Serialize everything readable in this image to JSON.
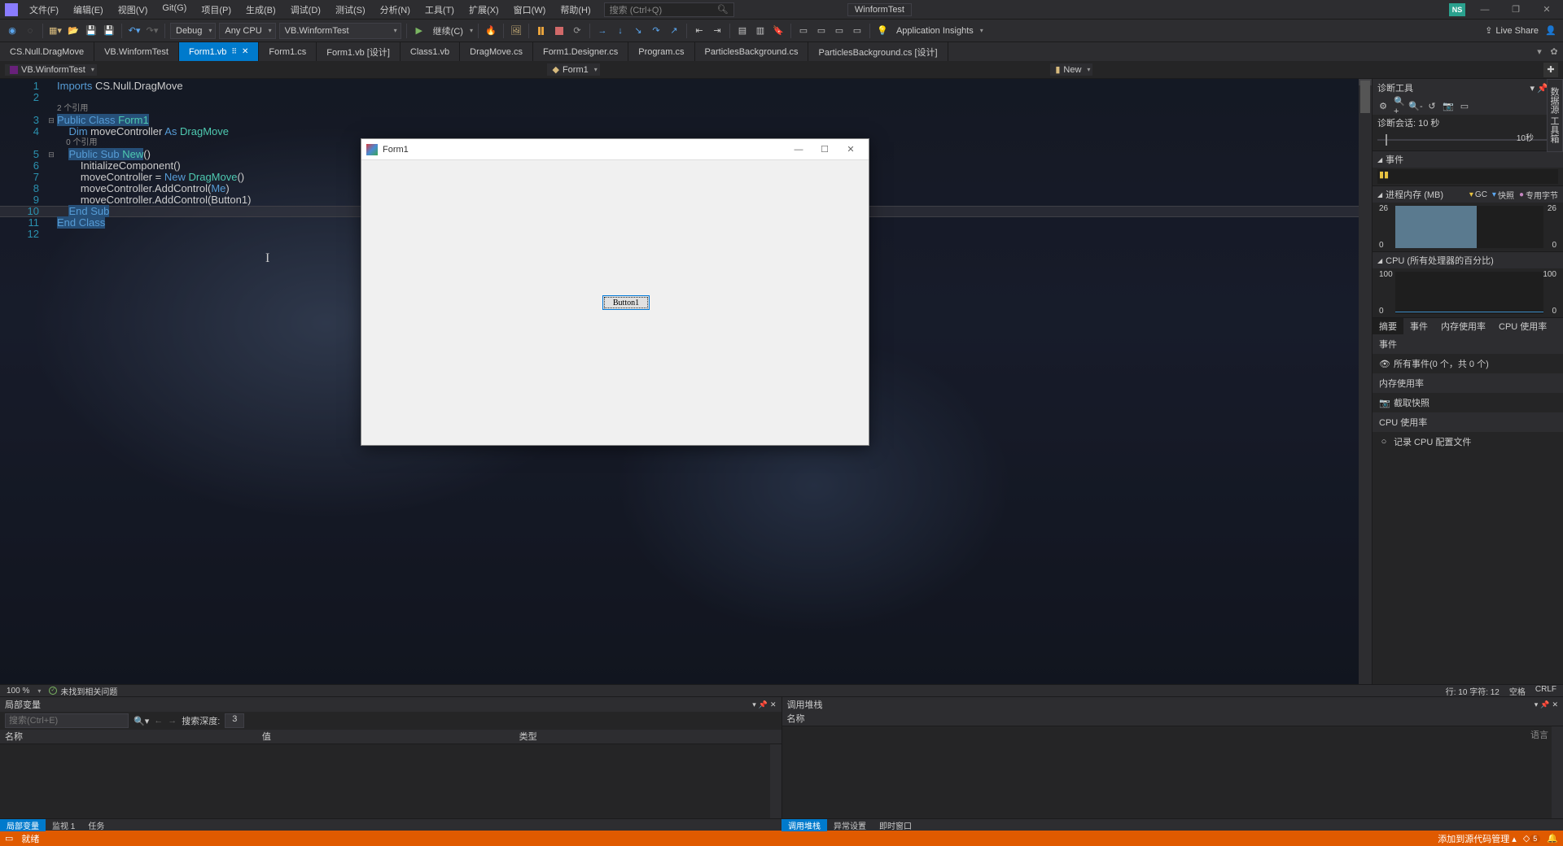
{
  "menu": [
    "文件(F)",
    "编辑(E)",
    "视图(V)",
    "Git(G)",
    "项目(P)",
    "生成(B)",
    "调试(D)",
    "测试(S)",
    "分析(N)",
    "工具(T)",
    "扩展(X)",
    "窗口(W)",
    "帮助(H)"
  ],
  "title_search_placeholder": "搜索 (Ctrl+Q)",
  "title_project": "WinformTest",
  "ns": "NS",
  "toolbar": {
    "config": "Debug",
    "platform": "Any CPU",
    "target": "VB.WinformTest",
    "continue": "继续(C)",
    "insights": "Application Insights",
    "live_share": "Live Share"
  },
  "tabs": [
    {
      "label": "CS.Null.DragMove",
      "active": false
    },
    {
      "label": "VB.WinformTest",
      "active": false
    },
    {
      "label": "Form1.vb",
      "active": true,
      "pinned": true,
      "close": true
    },
    {
      "label": "Form1.cs",
      "active": false
    },
    {
      "label": "Form1.vb [设计]",
      "active": false
    },
    {
      "label": "Class1.vb",
      "active": false
    },
    {
      "label": "DragMove.cs",
      "active": false
    },
    {
      "label": "Form1.Designer.cs",
      "active": false
    },
    {
      "label": "Program.cs",
      "active": false
    },
    {
      "label": "ParticlesBackground.cs",
      "active": false
    },
    {
      "label": "ParticlesBackground.cs [设计]",
      "active": false
    }
  ],
  "nav": {
    "scope": "VB.WinformTest",
    "class": "Form1",
    "member": "New"
  },
  "code": {
    "line_numbers": [
      "1",
      "2",
      "",
      "3",
      "4",
      "",
      "5",
      "6",
      "7",
      "8",
      "9",
      "10",
      "11",
      "12"
    ],
    "refs_2": "2 个引用",
    "refs_0": "0 个引用",
    "l1": "Imports CS.Null.DragMove",
    "l3a": "Public Class ",
    "l3b": "Form1",
    "l4a": "    Dim ",
    "l4b": "moveController ",
    "l4c": "As ",
    "l4d": "DragMove",
    "l5a": "    Public Sub ",
    "l5b": "New",
    "l5c": "()",
    "l6": "        InitializeComponent()",
    "l7a": "        moveController = ",
    "l7b": "New ",
    "l7c": "DragMove",
    "l7d": "()",
    "l8a": "        moveController.AddControl(",
    "l8b": "Me",
    "l8c": ")",
    "l9": "        moveController.AddControl(Button1)",
    "l10": "    End Sub",
    "l11": "End Class"
  },
  "ed_status": {
    "zoom": "100 %",
    "issues": "未找到相关问题",
    "pos": "行: 10    字符: 12",
    "ws": "空格",
    "eol": "CRLF"
  },
  "diag": {
    "title": "诊断工具",
    "session": "诊断会话: 10 秒",
    "timeline_end": "10秒",
    "sec_events": "事件",
    "sec_mem": "进程内存 (MB)",
    "mem_hi": "26",
    "mem_lo": "0",
    "mem_right_hi": "26",
    "mem_right_lo": "0",
    "leg_gc": "GC",
    "leg_snap": "快照",
    "leg_priv": "专用字节",
    "sec_cpu": "CPU (所有处理器的百分比)",
    "cpu_hi": "100",
    "cpu_lo": "0",
    "cpu_right_hi": "100",
    "cpu_right_lo": "0",
    "tabs": [
      "摘要",
      "事件",
      "内存使用率",
      "CPU 使用率"
    ],
    "grp_events": "事件",
    "item_events": "所有事件(0 个，共 0 个)",
    "grp_mem": "内存使用率",
    "item_snap": "截取快照",
    "grp_cpu": "CPU 使用率",
    "item_rec": "记录 CPU 配置文件"
  },
  "side_tab": "数据源 工具箱",
  "bottom": {
    "left_title": "局部变量",
    "right_title": "调用堆栈",
    "search_ph": "搜索(Ctrl+E)",
    "depth_label": "搜索深度:",
    "depth_val": "3",
    "col_name": "名称",
    "col_val": "值",
    "col_type": "类型",
    "col_name2": "名称",
    "lang": "语言",
    "left_tabs": [
      "局部变量",
      "监视 1",
      "任务"
    ],
    "right_tabs": [
      "调用堆栈",
      "异常设置",
      "即时窗口"
    ]
  },
  "status": {
    "ready": "就绪",
    "add_src": "添加到源代码管理",
    "repo_count": "5"
  },
  "form": {
    "title": "Form1",
    "button": "Button1"
  }
}
